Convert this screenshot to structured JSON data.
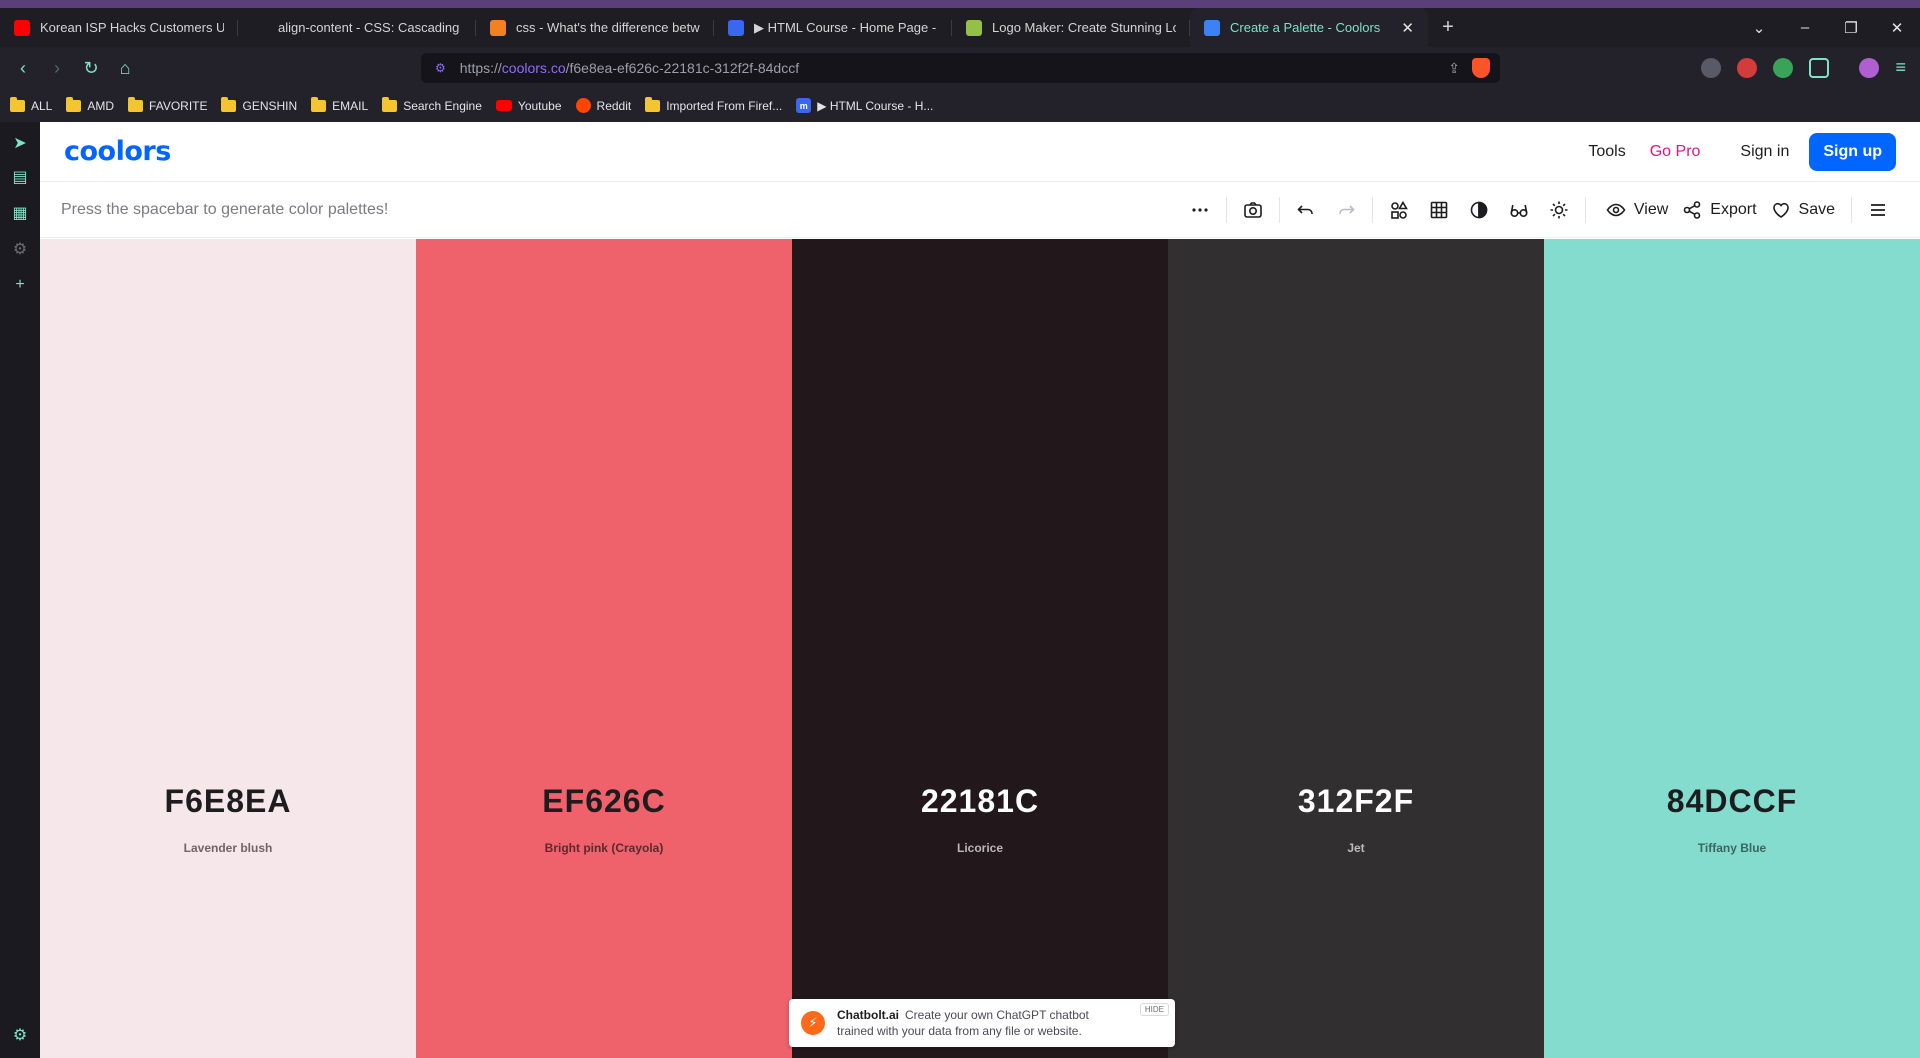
{
  "browser": {
    "tabs": [
      {
        "title": "Korean ISP Hacks Customers Using",
        "favicon_color": "#ff0000"
      },
      {
        "title": "align-content - CSS: Cascading Style",
        "favicon_color": "#1e1d24"
      },
      {
        "title": "css - What's the difference between",
        "favicon_color": "#f48024"
      },
      {
        "title": "▶ HTML Course - Home Page - Mon",
        "favicon_color": "#3868f2"
      },
      {
        "title": "Logo Maker: Create Stunning Logos",
        "favicon_color": "#95bf47"
      },
      {
        "title": "Create a Palette - Coolors",
        "favicon_color": "#3b82f6",
        "active": true
      }
    ],
    "url_prefix": "https://",
    "url_domain": "coolors.co",
    "url_path": "/f6e8ea-ef626c-22181c-312f2f-84dccf",
    "bookmarks": [
      {
        "label": "ALL",
        "type": "folder"
      },
      {
        "label": "AMD",
        "type": "folder"
      },
      {
        "label": "FAVORITE",
        "type": "folder"
      },
      {
        "label": "GENSHIN",
        "type": "folder"
      },
      {
        "label": "EMAIL",
        "type": "folder"
      },
      {
        "label": "Search Engine",
        "type": "folder"
      },
      {
        "label": "Youtube",
        "type": "youtube"
      },
      {
        "label": "Reddit",
        "type": "reddit"
      },
      {
        "label": "Imported From Firef...",
        "type": "folder"
      },
      {
        "label": "▶ HTML Course - H...",
        "type": "mimo"
      }
    ]
  },
  "nav": {
    "logo": "coolors",
    "tools": "Tools",
    "go_pro": "Go Pro",
    "sign_in": "Sign in",
    "sign_up": "Sign up"
  },
  "toolbar": {
    "hint": "Press the spacebar to generate color palettes!",
    "view": "View",
    "export": "Export",
    "save": "Save"
  },
  "palette": [
    {
      "hex": "F6E8EA",
      "name": "Lavender blush",
      "bg": "#f6e8ea",
      "text": "#1d1d1f",
      "sub": "#6f6466"
    },
    {
      "hex": "EF626C",
      "name": "Bright pink (Crayola)",
      "bg": "#ef626c",
      "text": "#1d1d1f",
      "sub": "#5a2a2e"
    },
    {
      "hex": "22181C",
      "name": "Licorice",
      "bg": "#22181c",
      "text": "#ffffff",
      "sub": "#bcb6b8"
    },
    {
      "hex": "312F2F",
      "name": "Jet",
      "bg": "#312f2f",
      "text": "#ffffff",
      "sub": "#bdbcbc"
    },
    {
      "hex": "84DCCF",
      "name": "Tiffany Blue",
      "bg": "#84dccf",
      "text": "#1d1d1f",
      "sub": "#3b6660"
    }
  ],
  "promo": {
    "brand": "Chatbolt.ai",
    "line1": "Create your own ChatGPT chatbot",
    "line2": "trained with your data from any file or website.",
    "hide": "HIDE"
  }
}
